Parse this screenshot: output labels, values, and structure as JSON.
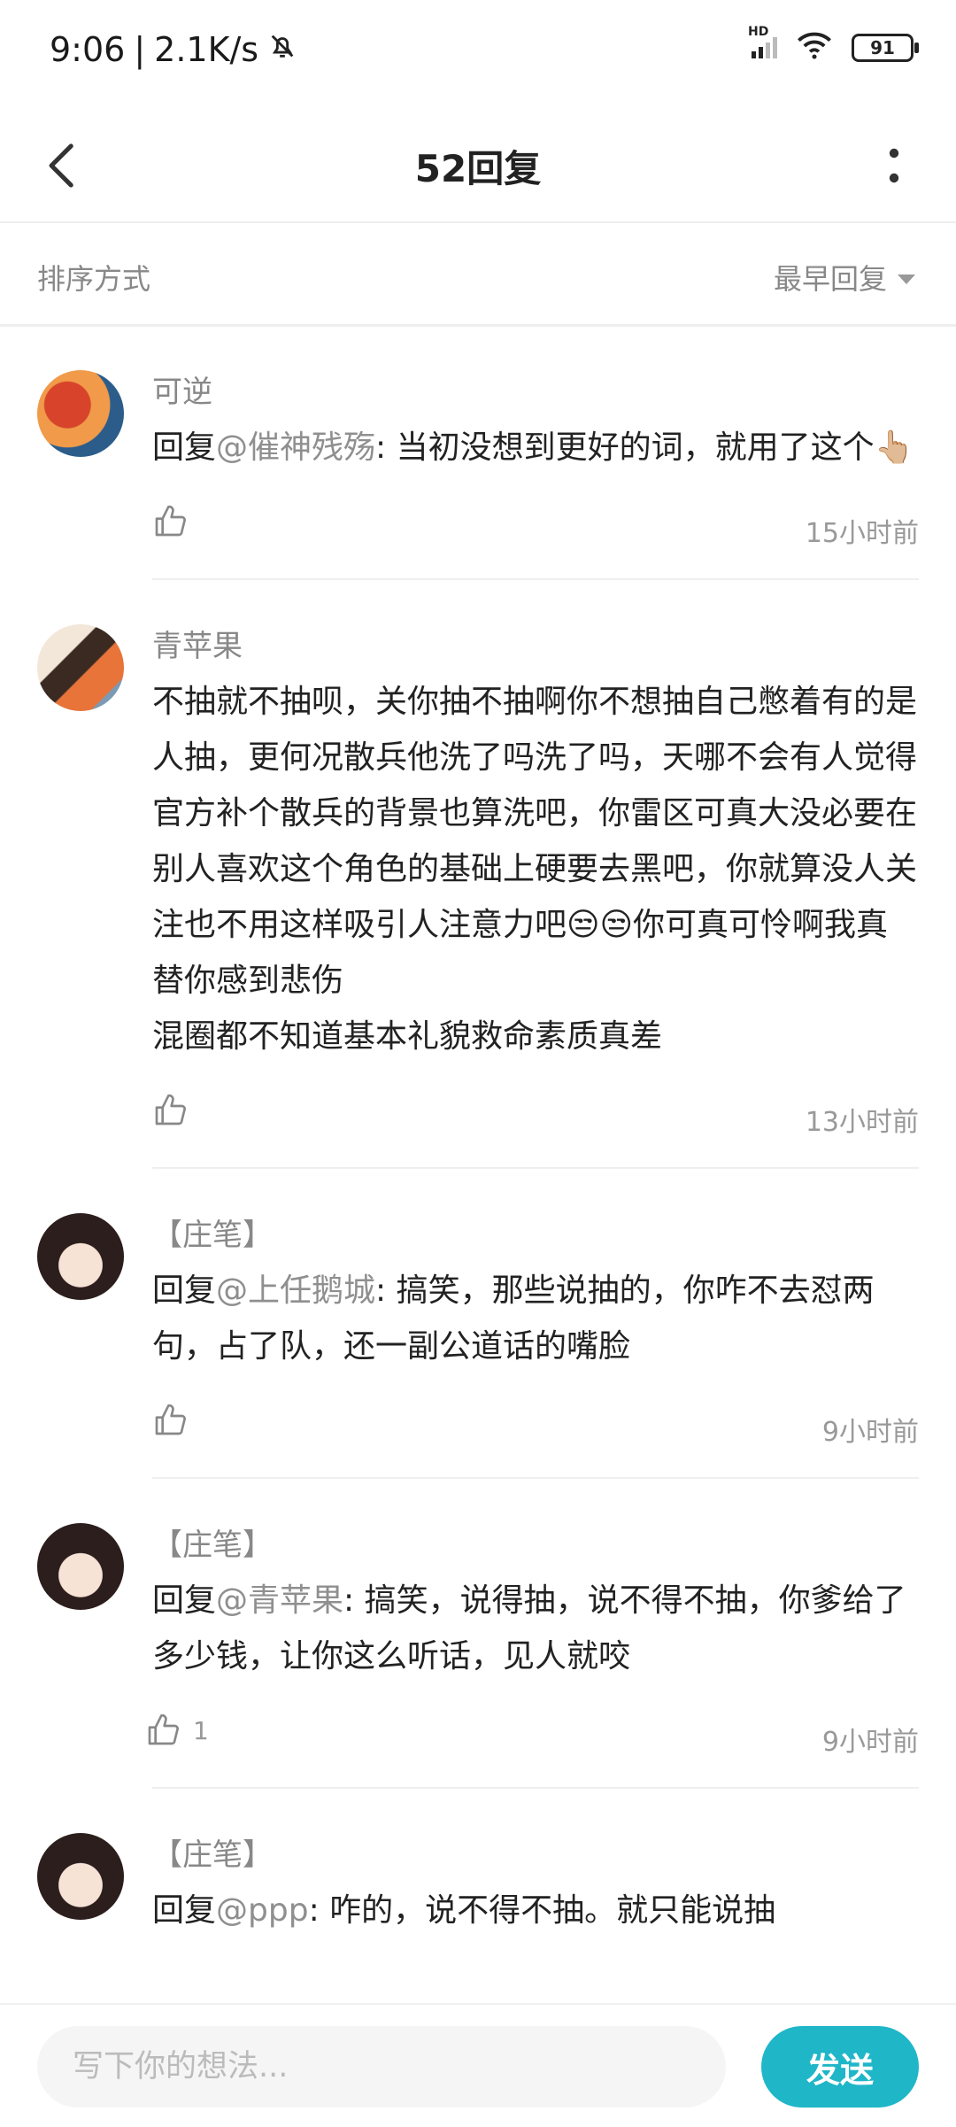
{
  "status_bar": {
    "time": "9:06",
    "separator": "|",
    "speed": "2.1K/s",
    "network": "HD",
    "battery": "91"
  },
  "header": {
    "title": "52回复"
  },
  "sort": {
    "label": "排序方式",
    "value": "最早回复"
  },
  "comments": [
    {
      "name": "可逆",
      "reply_prefix": "回复",
      "reply_to": "@催神残殇",
      "text": ": 当初没想到更好的词，就用了这个👆🏼",
      "likes": "",
      "time": "15小时前"
    },
    {
      "name": "青苹果",
      "reply_prefix": "",
      "reply_to": "",
      "text": "不抽就不抽呗，关你抽不抽啊你不想抽自己憋着有的是人抽，更何况散兵他洗了吗洗了吗，天哪不会有人觉得官方补个散兵的背景也算洗吧，你雷区可真大没必要在别人喜欢这个角色的基础上硬要去黑吧，你就算没人关注也不用这样吸引人注意力吧😒😒你可真可怜啊我真替你感到悲伤\n混圈都不知道基本礼貌救命素质真差",
      "likes": "",
      "time": "13小时前"
    },
    {
      "name": "【庄笔】",
      "reply_prefix": "回复",
      "reply_to": "@上任鹅城",
      "text": ": 搞笑，那些说抽的，你咋不去怼两句，占了队，还一副公道话的嘴脸",
      "likes": "",
      "time": "9小时前"
    },
    {
      "name": "【庄笔】",
      "reply_prefix": "回复",
      "reply_to": "@青苹果",
      "text": ": 搞笑，说得抽，说不得不抽，你爹给了多少钱，让你这么听话，见人就咬",
      "likes": "1",
      "time": "9小时前"
    },
    {
      "name": "【庄笔】",
      "reply_prefix": "回复",
      "reply_to": "@ppp",
      "text": ": 咋的，说不得不抽。就只能说抽",
      "likes": "",
      "time": ""
    }
  ],
  "composer": {
    "placeholder": "写下你的想法...",
    "send_label": "发送"
  },
  "colors": {
    "accent": "#1fb6c8",
    "muted": "#888888"
  }
}
